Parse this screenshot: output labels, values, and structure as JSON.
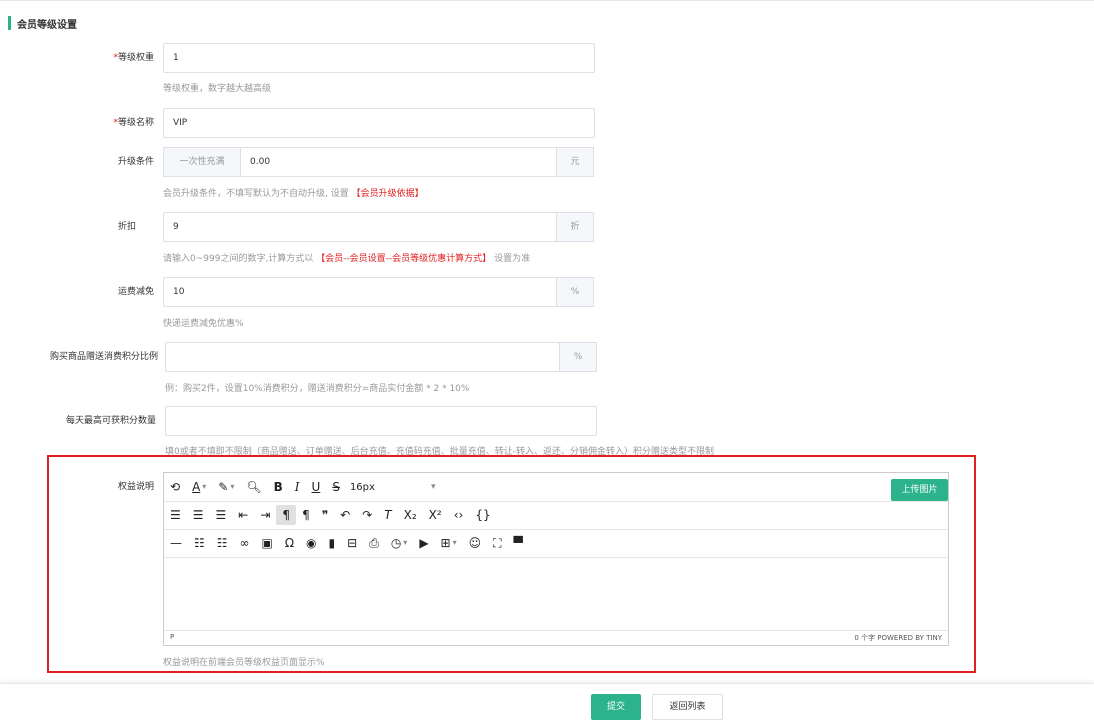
{
  "section": {
    "title": "会员等级设置"
  },
  "fields": {
    "level_weight": {
      "label": "等级权重",
      "value": "1",
      "hint": "等级权重，数字越大越高级"
    },
    "level_name": {
      "label": "等级名称",
      "value": "VIP"
    },
    "upgrade": {
      "label": "升级条件",
      "prefix": "一次性充满",
      "value": "0.00",
      "suffix": "元",
      "hint": "会员升级条件，不填写默认为不自动升级, 设置",
      "hint_link": "【会员升级依据】"
    },
    "discount": {
      "label": "折扣",
      "value": "9",
      "suffix": "折",
      "hint": "请输入0~999之间的数字,计算方式以",
      "hint_link": "【会员--会员设置--会员等级优惠计算方式】",
      "hint_after": "设置为准"
    },
    "shipping": {
      "label": "运费减免",
      "value": "10",
      "suffix": "%",
      "hint": "快递运费减免优惠%"
    },
    "purchase_points": {
      "label": "购买商品赠送消费积分比例",
      "value": "",
      "suffix": "%",
      "hint": "例：购买2件，设置10%消费积分，赠送消费积分=商品实付金额 * 2 * 10%"
    },
    "daily_points": {
      "label": "每天最高可获积分数量",
      "value": "",
      "hint": "填0或者不填即不限制（商品赠送、订单赠送、后台充值、充值码充值、批量充值、转让-转入、返还、分销佣金转入）积分赠送类型不限制"
    },
    "benefits": {
      "label": "权益说明",
      "hint": "权益说明在前端会员等级权益页面显示%"
    }
  },
  "editor": {
    "font_size": "16px",
    "upload_label": "上传图片",
    "status_path": "P",
    "status_right": "0 个字  POWERED BY TINY"
  },
  "footer": {
    "submit": "提交",
    "back": "返回列表"
  },
  "colors": {
    "accent": "#2cb38b",
    "required": "#e02020",
    "highlight": "#e02020"
  }
}
